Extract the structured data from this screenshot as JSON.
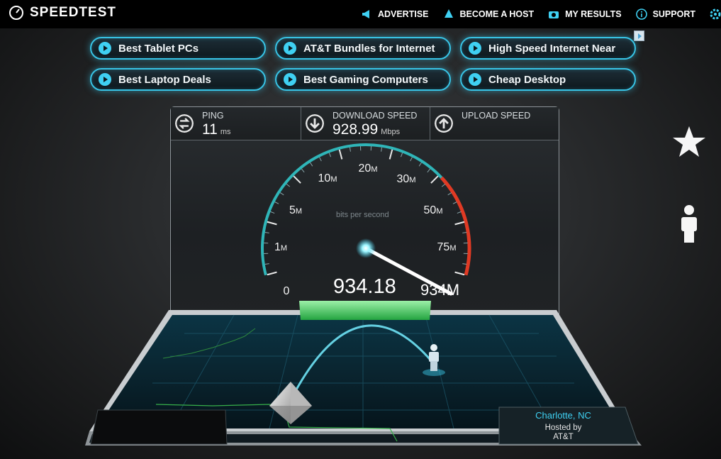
{
  "app": {
    "logo_text": "SPEEDTEST"
  },
  "nav": {
    "advertise": "ADVERTISE",
    "become_host": "BECOME A HOST",
    "my_results": "MY RESULTS",
    "support": "SUPPORT"
  },
  "ads": [
    {
      "label": "Best Tablet PCs"
    },
    {
      "label": "AT&T Bundles for Internet"
    },
    {
      "label": "High Speed Internet Near"
    },
    {
      "label": "Best Laptop Deals"
    },
    {
      "label": "Best Gaming Computers"
    },
    {
      "label": "Cheap Desktop"
    }
  ],
  "metrics": {
    "ping": {
      "label": "PING",
      "value": "11",
      "unit": "ms"
    },
    "download": {
      "label": "DOWNLOAD SPEED",
      "value": "928.99",
      "unit": "Mbps"
    },
    "upload": {
      "label": "UPLOAD SPEED"
    }
  },
  "gauge": {
    "subtitle": "bits per second",
    "current_value": "934.18",
    "needle_label": "934M",
    "scale": [
      {
        "big": "0",
        "small": ""
      },
      {
        "big": "1",
        "small": "M"
      },
      {
        "big": "5",
        "small": "M"
      },
      {
        "big": "10",
        "small": "M"
      },
      {
        "big": "20",
        "small": "M"
      },
      {
        "big": "30",
        "small": "M"
      },
      {
        "big": "50",
        "small": "M"
      },
      {
        "big": "75",
        "small": "M"
      }
    ]
  },
  "server": {
    "city": "Charlotte, NC",
    "hosted_by": "Hosted by",
    "isp": "AT&T"
  },
  "colors": {
    "accent": "#3fd0f2",
    "gauge_teal": "#2fb5b8",
    "gauge_red": "#e03a24",
    "bar_green": "#3ec45a"
  }
}
